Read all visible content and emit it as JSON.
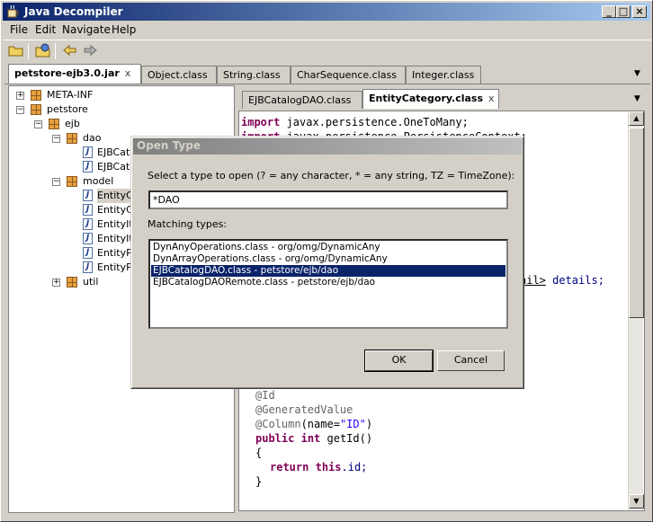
{
  "window": {
    "title": "Java Decompiler"
  },
  "menu": {
    "file": "File",
    "edit": "Edit",
    "navigate": "Navigate",
    "help": "Help"
  },
  "main_tabs": [
    {
      "label": "petstore-ejb3.0.jar",
      "close": "x"
    },
    {
      "label": "Object.class"
    },
    {
      "label": "String.class"
    },
    {
      "label": "CharSequence.class"
    },
    {
      "label": "Integer.class"
    }
  ],
  "tree": {
    "meta_inf": "META-INF",
    "petstore": "petstore",
    "ejb": "ejb",
    "dao": "dao",
    "dao_items": [
      "EJBCata",
      "EJBCata"
    ],
    "model": "model",
    "model_items": [
      "EntityC",
      "EntityC",
      "EntityIt",
      "EntityIt",
      "EntityPr",
      "EntityPr"
    ],
    "util": "util",
    "expander_plus": "+",
    "expander_minus": "−",
    "class_glyph": "J"
  },
  "editor_tabs": [
    {
      "label": "EJBCatalogDAO.class"
    },
    {
      "label": "EntityCategory.class",
      "close": "x"
    }
  ],
  "code": {
    "line1_kw": "import",
    "line1_rest": " javax.persistence.OneToMany;",
    "line2_kw": "import",
    "line2_rest": " javax.persistence.PersistenceContext;",
    "details_frag1": "ail>",
    "details_frag2": " details;",
    "ann_id": "@Id",
    "ann_gen": "@GeneratedValue",
    "ann_col": "@Column",
    "col_open": "(name=",
    "col_str": "\"ID\"",
    "col_close": ")",
    "sig_kw1": "public",
    "sig_kw2": "int",
    "sig_rest": " getId()",
    "brace_open": "{",
    "ret_kw": "return",
    "ret_this": "this",
    "ret_rest": ".id;",
    "brace_close": "}"
  },
  "dialog": {
    "title": "Open Type",
    "prompt": "Select a type to open (? = any character, * = any string, TZ = TimeZone):",
    "input_value": "*DAO",
    "matching_label": "Matching types:",
    "matches": [
      "DynAnyOperations.class  -  org/omg/DynamicAny",
      "DynArrayOperations.class  -  org/omg/DynamicAny",
      "EJBCatalogDAO.class  -  petstore/ejb/dao",
      "EJBCatalogDAORemote.class  -  petstore/ejb/dao"
    ],
    "selected_index": 2,
    "ok_label": "OK",
    "cancel_label": "Cancel"
  },
  "glyphs": {
    "minimize": "_",
    "maximize": "□",
    "close": "×",
    "dropdown": "▼",
    "scroll_up": "▲",
    "scroll_down": "▼"
  },
  "colors": {
    "titlebar": "#0a246a",
    "selection": "#0a246a",
    "keyword": "#7f0055",
    "string": "#2a00ff"
  }
}
